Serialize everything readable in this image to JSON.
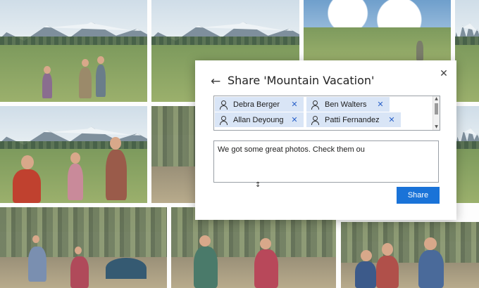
{
  "dialog": {
    "title": "Share 'Mountain Vacation'",
    "back_icon": "arrow-left-icon",
    "close_icon": "close-icon",
    "recipients": [
      {
        "name": "Debra Berger"
      },
      {
        "name": "Ben Walters"
      },
      {
        "name": "Allan Deyoung"
      },
      {
        "name": "Patti Fernandez"
      }
    ],
    "message": "We got some great photos. Check them ou",
    "share_label": "Share"
  },
  "colors": {
    "accent": "#1a73d8",
    "chip_background": "#d9e5f6",
    "dialog_background": "#ffffff"
  },
  "icons": {
    "recipient": "person-icon",
    "remove": "remove-x-icon"
  }
}
